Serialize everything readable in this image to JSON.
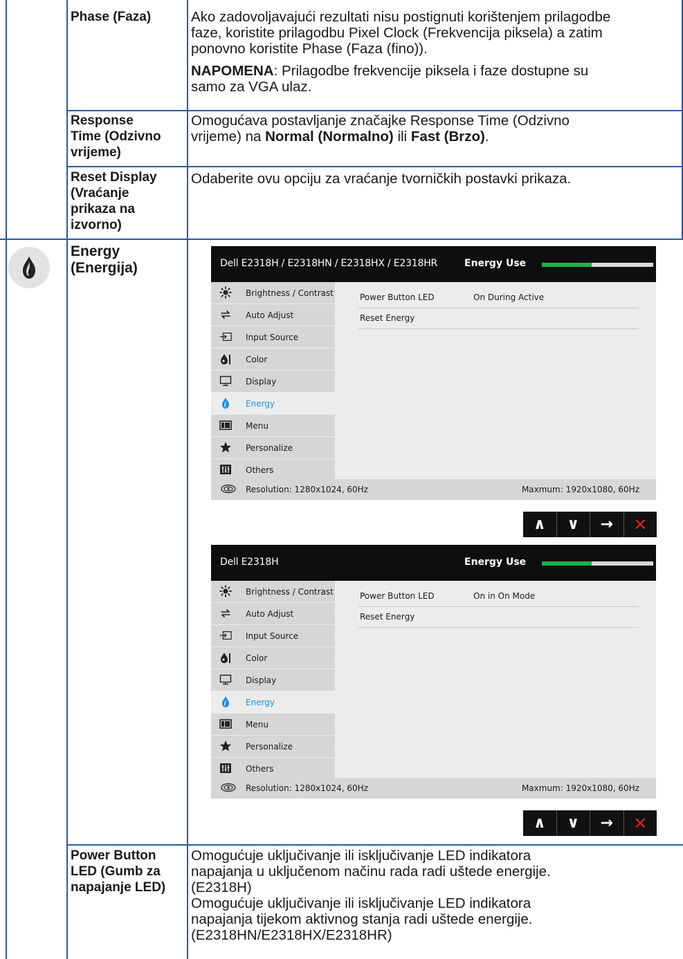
{
  "rows": {
    "phase": {
      "label": "Phase (Faza)",
      "desc_line1": "Ako zadovoljavajući rezultati nisu postignuti korištenjem prilagodbe",
      "desc_line2": "faze, koristite prilagodbu Pixel Clock (Frekvencija piksela) a zatim",
      "desc_line3": "ponovno koristite Phase (Faza (fino)).",
      "note_label": "NAPOMENA",
      "note_line1": ": Prilagodbe frekvencije piksela i faze dostupne su",
      "note_line2": "samo za VGA ulaz."
    },
    "response": {
      "label_line1": "Response",
      "label_line2": "Time (Odzivno",
      "label_line3": "vrijeme)",
      "desc_line1": "Omogućava postavljanje značajke Response Time (Odzivno",
      "desc_pre": "vrijeme) na ",
      "desc_opt1": "Normal (Normalno)",
      "desc_mid": " ili ",
      "desc_opt2": "Fast (Brzo)",
      "desc_post": "."
    },
    "reset": {
      "label_line1": "Reset Display",
      "label_line2": "(Vraćanje",
      "label_line3": "prikaza na",
      "label_line4": "izvorno)",
      "desc": "Odaberite ovu opciju za vraćanje tvorničkih postavki prikaza."
    },
    "energy": {
      "label_line1": "Energy",
      "label_line2": "(Energija)",
      "icon": "flame-drop-icon"
    },
    "power_led": {
      "label_line1": "Power Button",
      "label_line2": "LED (Gumb za",
      "label_line3": "napajanje LED)",
      "desc_line1": "Omogućuje uključivanje ili isključivanje LED indikatora",
      "desc_line2": "napajanja u uključenom načinu rada radi uštede energije.",
      "desc_line3": "(E2318H)",
      "desc_line4": "Omogućuje uključivanje ili isključivanje LED indikatora",
      "desc_line5": "napajanja tijekom aktivnog stanja radi uštede energije.",
      "desc_line6": "(E2318HN/E2318HX/E2318HR)"
    }
  },
  "osd_menu": [
    {
      "label": "Brightness / Contrast",
      "icon": "sun-icon"
    },
    {
      "label": "Auto Adjust",
      "icon": "arrows-icon"
    },
    {
      "label": "Input Source",
      "icon": "input-icon"
    },
    {
      "label": "Color",
      "icon": "palette-icon"
    },
    {
      "label": "Display",
      "icon": "monitor-icon"
    },
    {
      "label": "Energy",
      "icon": "energy-icon"
    },
    {
      "label": "Menu",
      "icon": "menu-icon"
    },
    {
      "label": "Personalize",
      "icon": "star-icon"
    },
    {
      "label": "Others",
      "icon": "others-icon"
    }
  ],
  "osd1": {
    "model": "Dell E2318H / E2318HN / E2318HX / E2318HR",
    "tag": "Energy Use",
    "energy_level": 0.45,
    "settings": [
      {
        "key": "Power Button LED",
        "value": "On During Active"
      },
      {
        "key": "Reset Energy",
        "value": ""
      }
    ],
    "resolution": "Resolution: 1280x1024, 60Hz",
    "maximum": "Maxmum: 1920x1080, 60Hz"
  },
  "osd2": {
    "model": "Dell E2318H",
    "tag": "Energy Use",
    "energy_level": 0.45,
    "settings": [
      {
        "key": "Power Button LED",
        "value": "On in On Mode"
      },
      {
        "key": "Reset Energy",
        "value": ""
      }
    ],
    "resolution": "Resolution: 1280x1024, 60Hz",
    "maximum": "Maxmum: 1920x1080, 60Hz"
  },
  "nav_buttons": [
    "∧",
    "∨",
    "→",
    "✕"
  ],
  "colors": {
    "table_border": "#2a5d9f",
    "active": "#1f8fe0",
    "energy_bar": "#1bb24a",
    "close": "#e12020"
  }
}
